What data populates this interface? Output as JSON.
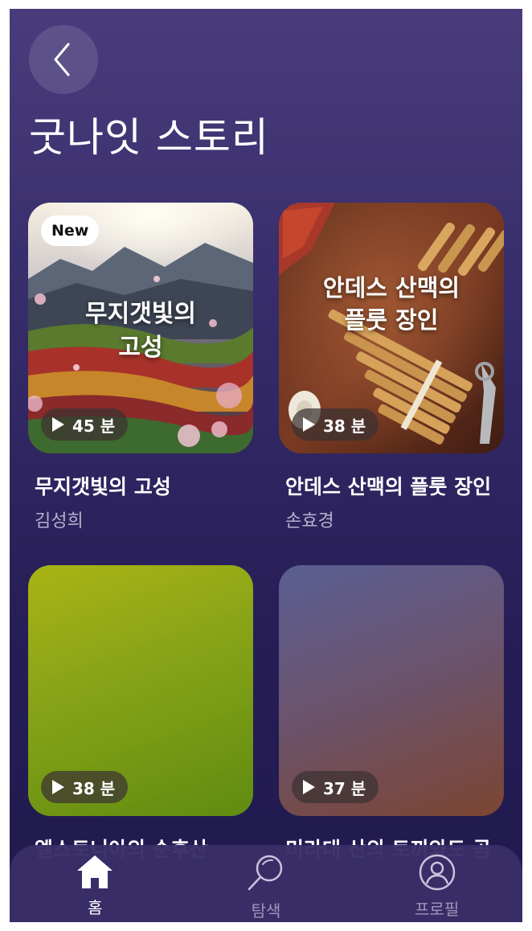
{
  "header": {
    "title": "굿나잇 스토리"
  },
  "stories": [
    {
      "badge": "New",
      "cover_text": [
        "무지갯빛의",
        "고성"
      ],
      "duration": "45 분",
      "title": "무지갯빛의 고성",
      "author": "김성희"
    },
    {
      "badge": "",
      "cover_text": [
        "안데스 산맥의",
        "플룻 장인"
      ],
      "duration": "38 분",
      "title": "안데스 산맥의 플룻 장인",
      "author": "손효경"
    },
    {
      "duration": "38 분",
      "title": "엘스토니아의 순후산"
    },
    {
      "duration": "37 분",
      "title": "미라대 산의 토끼와도 곰"
    }
  ],
  "tabbar": {
    "items": [
      {
        "label": "홈",
        "icon": "home-icon",
        "active": true
      },
      {
        "label": "탐색",
        "icon": "search-icon",
        "active": false
      },
      {
        "label": "프로필",
        "icon": "profile-icon",
        "active": false
      }
    ]
  },
  "colors": {
    "background_top": "#4a3c7c",
    "background_bottom": "#201a4d",
    "tab_active": "#ffffff",
    "tab_inactive": "#9c95ba"
  }
}
